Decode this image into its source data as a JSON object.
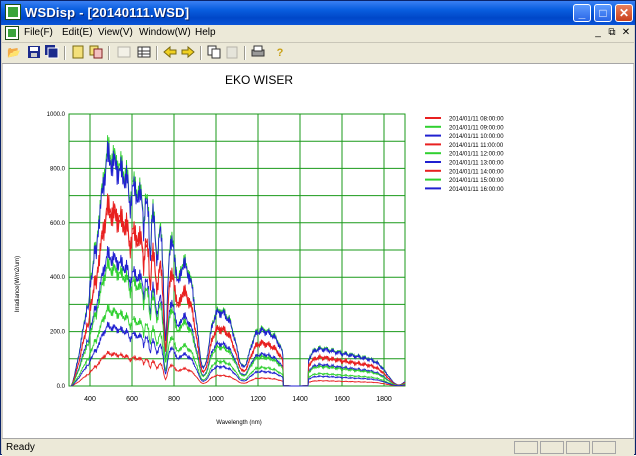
{
  "titlebar": {
    "title": "WSDisp - [20140111.WSD]"
  },
  "window_buttons": {
    "minimize": "_",
    "maximize": "□",
    "close": "✕"
  },
  "menu": {
    "items": [
      "File(F)",
      "Edit(E)",
      "View(V)",
      "Window(W)",
      "Help"
    ],
    "mdi_controls": [
      "_",
      "⧉",
      "✕"
    ]
  },
  "toolbar": {
    "icons": [
      "open-icon",
      "save-icon",
      "save-all-icon",
      "page-icon",
      "copy-page-icon",
      "image-icon",
      "table-icon",
      "arrow-left-icon",
      "arrow-right-icon",
      "copy-icon",
      "paste-icon",
      "print-icon",
      "help-icon"
    ]
  },
  "chart_title": "EKO WISER",
  "status": {
    "text": "Ready"
  },
  "chart_data": {
    "type": "line",
    "title": "EKO WISER",
    "xlabel": "Wavelength (nm)",
    "ylabel": "Irradiance(W/m2/um)",
    "xlim": [
      300,
      1900
    ],
    "ylim": [
      0,
      1000
    ],
    "x_ticks": [
      "400",
      "600",
      "800",
      "1000",
      "1200",
      "1400",
      "1600",
      "1800"
    ],
    "y_ticks": [
      "0.0",
      "200.0",
      "400.0",
      "600.0",
      "800.0",
      "1000.0"
    ],
    "grid": true,
    "legend_position": "top-right",
    "series": [
      {
        "name": "2014/01/11  08:00:00",
        "color": "#e82020",
        "peak": 120
      },
      {
        "name": "2014/01/11  09:00:00",
        "color": "#30d030",
        "peak": 280
      },
      {
        "name": "2014/01/11  10:00:00",
        "color": "#2020d0",
        "peak": 480
      },
      {
        "name": "2014/01/11  11:00:00",
        "color": "#e82020",
        "peak": 640
      },
      {
        "name": "2014/01/11  12:00:00",
        "color": "#30d030",
        "peak": 860
      },
      {
        "name": "2014/01/11  13:00:00",
        "color": "#2020d0",
        "peak": 840
      },
      {
        "name": "2014/01/11  14:00:00",
        "color": "#e82020",
        "peak": 660
      },
      {
        "name": "2014/01/11  15:00:00",
        "color": "#30d030",
        "peak": 440
      },
      {
        "name": "2014/01/11  16:00:00",
        "color": "#2020d0",
        "peak": 220
      }
    ]
  }
}
